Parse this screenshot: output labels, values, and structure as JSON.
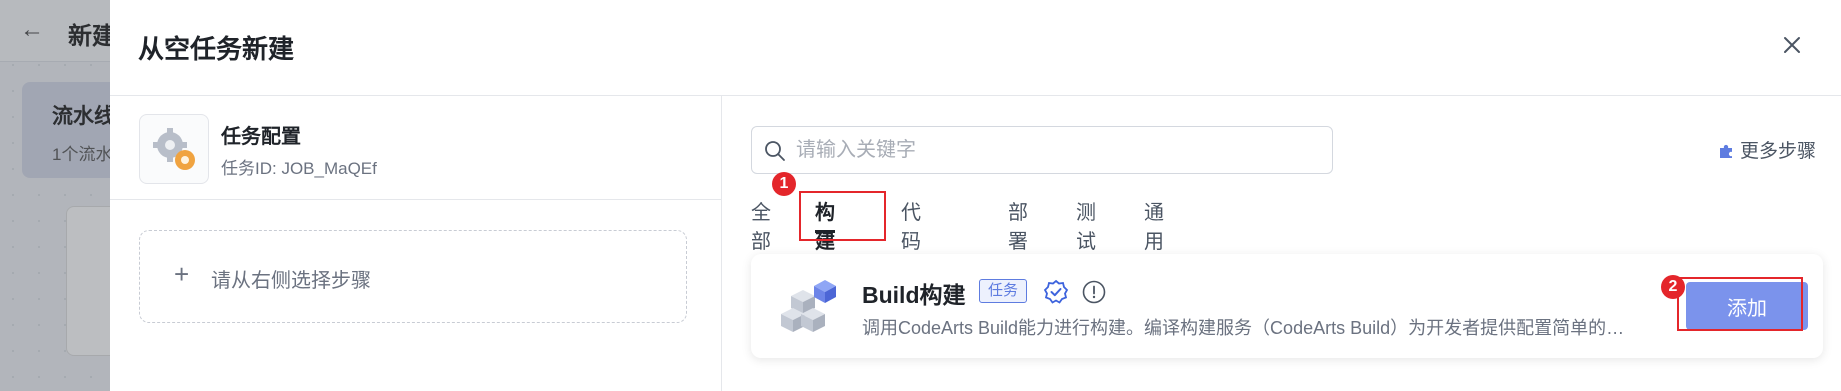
{
  "background": {
    "back_icon": "arrow-left-icon",
    "title_fragment": "新建",
    "card_title_fragment": "流水线",
    "card_sub_fragment": "1个流水"
  },
  "drawer": {
    "title": "从空任务新建",
    "close_icon": "close-icon"
  },
  "task": {
    "name": "任务配置",
    "id_text": "任务ID: JOB_MaQEf",
    "add_step_plus": "+",
    "add_step_text": "请从右侧选择步骤"
  },
  "search": {
    "placeholder": "请输入关键字",
    "value": ""
  },
  "more_steps": {
    "label": "更多步骤",
    "icon": "puzzle-icon"
  },
  "tabs": [
    {
      "label": "全部",
      "active": false
    },
    {
      "label": "构建",
      "active": true
    },
    {
      "label": "代码检查",
      "active": false
    },
    {
      "label": "部署",
      "active": false
    },
    {
      "label": "测试",
      "active": false
    },
    {
      "label": "通用",
      "active": false
    }
  ],
  "step": {
    "name": "Build构建",
    "badge": "任务",
    "description": "调用CodeArts Build能力进行构建。编译构建服务（CodeArts Build）为开发者提供配置简单的混合语言构建平台",
    "add_label": "添加"
  },
  "markers": [
    "1",
    "2"
  ],
  "colors": {
    "accent": "#7b93ec",
    "badge_blue": "#5e7ce0",
    "highlight_red": "#e4262b"
  }
}
